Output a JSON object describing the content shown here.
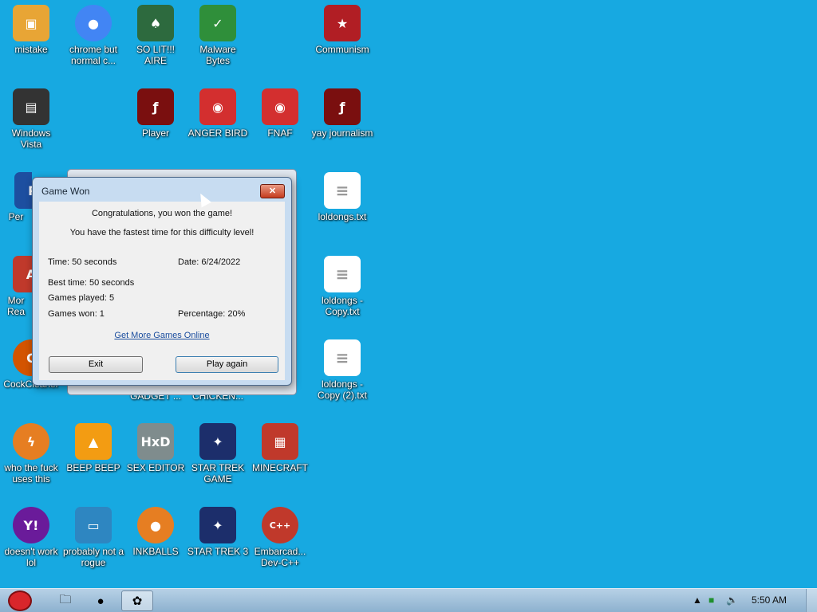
{
  "desktop_icons": [
    {
      "label": "mistake",
      "icon": "folder-icon",
      "color": "#e8a535"
    },
    {
      "label": "chrome but normal c...",
      "icon": "chrome-icon",
      "color": "#4285f4"
    },
    {
      "label": "SO LIT!!! AIRE",
      "icon": "solitaire-icon",
      "color": "#2d6a3e"
    },
    {
      "label": "Malware Bytes",
      "icon": "shield-icon",
      "color": "#2f8f3a"
    },
    {
      "label": "Communism",
      "icon": "emblem-icon",
      "color": "#b11e24"
    },
    {
      "label": "Windows Vista",
      "icon": "trash-icon",
      "color": "#333333"
    },
    {
      "label": "Player",
      "icon": "flash-icon",
      "color": "#7a0f0f"
    },
    {
      "label": "ANGER BIRD",
      "icon": "angry-bird-icon",
      "color": "#d32f2f"
    },
    {
      "label": "FNAF",
      "icon": "angry-bird-icon",
      "color": "#d32f2f"
    },
    {
      "label": "yay journalism",
      "icon": "flash-icon",
      "color": "#7a0f0f"
    },
    {
      "label": "Per",
      "icon": "app-icon",
      "color": "#1d4fa0"
    },
    {
      "label": "Mor Rea",
      "icon": "pdf-icon",
      "color": "#c0392b"
    },
    {
      "label": "CockCleaner",
      "icon": "cleaner-icon",
      "color": "#d35400"
    },
    {
      "label": "who the fuck uses this",
      "icon": "lightning-icon",
      "color": "#e67e22"
    },
    {
      "label": "BEEP BEEP",
      "icon": "vlc-icon",
      "color": "#f39c12"
    },
    {
      "label": "SEX EDITOR",
      "icon": "hxd-icon",
      "color": "#7f8c8d"
    },
    {
      "label": "STAR TREK GAME",
      "icon": "game-icon",
      "color": "#1c2e6b"
    },
    {
      "label": "MINECRAFT",
      "icon": "game-icon",
      "color": "#c0392b"
    },
    {
      "label": "doesn't work lol",
      "icon": "yahoo-icon",
      "color": "#6a1b9a"
    },
    {
      "label": "probably not a rogue",
      "icon": "monitor-icon",
      "color": "#2e86c1"
    },
    {
      "label": "INKBALLS",
      "icon": "ball-icon",
      "color": "#e67e22"
    },
    {
      "label": "STAR TREK 3",
      "icon": "game-icon",
      "color": "#1c2e6b"
    },
    {
      "label": "Embarcad... Dev-C++",
      "icon": "devcpp-icon",
      "color": "#c0392b"
    },
    {
      "label": "GADGET ...",
      "icon": "",
      "color": ""
    },
    {
      "label": "CHICKEN...",
      "icon": "",
      "color": ""
    },
    {
      "label": "loldongs.txt",
      "icon": "text-file-icon",
      "color": "#ffffff"
    },
    {
      "label": "loldongs - Copy.txt",
      "icon": "text-file-icon",
      "color": "#ffffff"
    },
    {
      "label": "loldongs - Copy (2).txt",
      "icon": "text-file-icon",
      "color": "#ffffff"
    }
  ],
  "dialog": {
    "title": "Game Won",
    "close_glyph": "✕",
    "congrats": "Congratulations, you won the game!",
    "fastest": "You have the fastest time for this difficulty level!",
    "time": "Time: 50 seconds",
    "date": "Date: 6/24/2022",
    "best_time": "Best time: 50 seconds",
    "games_played": "Games played: 5",
    "games_won": "Games won: 1",
    "percentage": "Percentage: 20%",
    "link": "Get More Games Online",
    "exit_label": "Exit",
    "play_again_label": "Play again"
  },
  "taskbar": {
    "clock": "5:50 AM",
    "items": [
      "explorer-icon",
      "chrome-icon",
      "game-icon"
    ]
  }
}
